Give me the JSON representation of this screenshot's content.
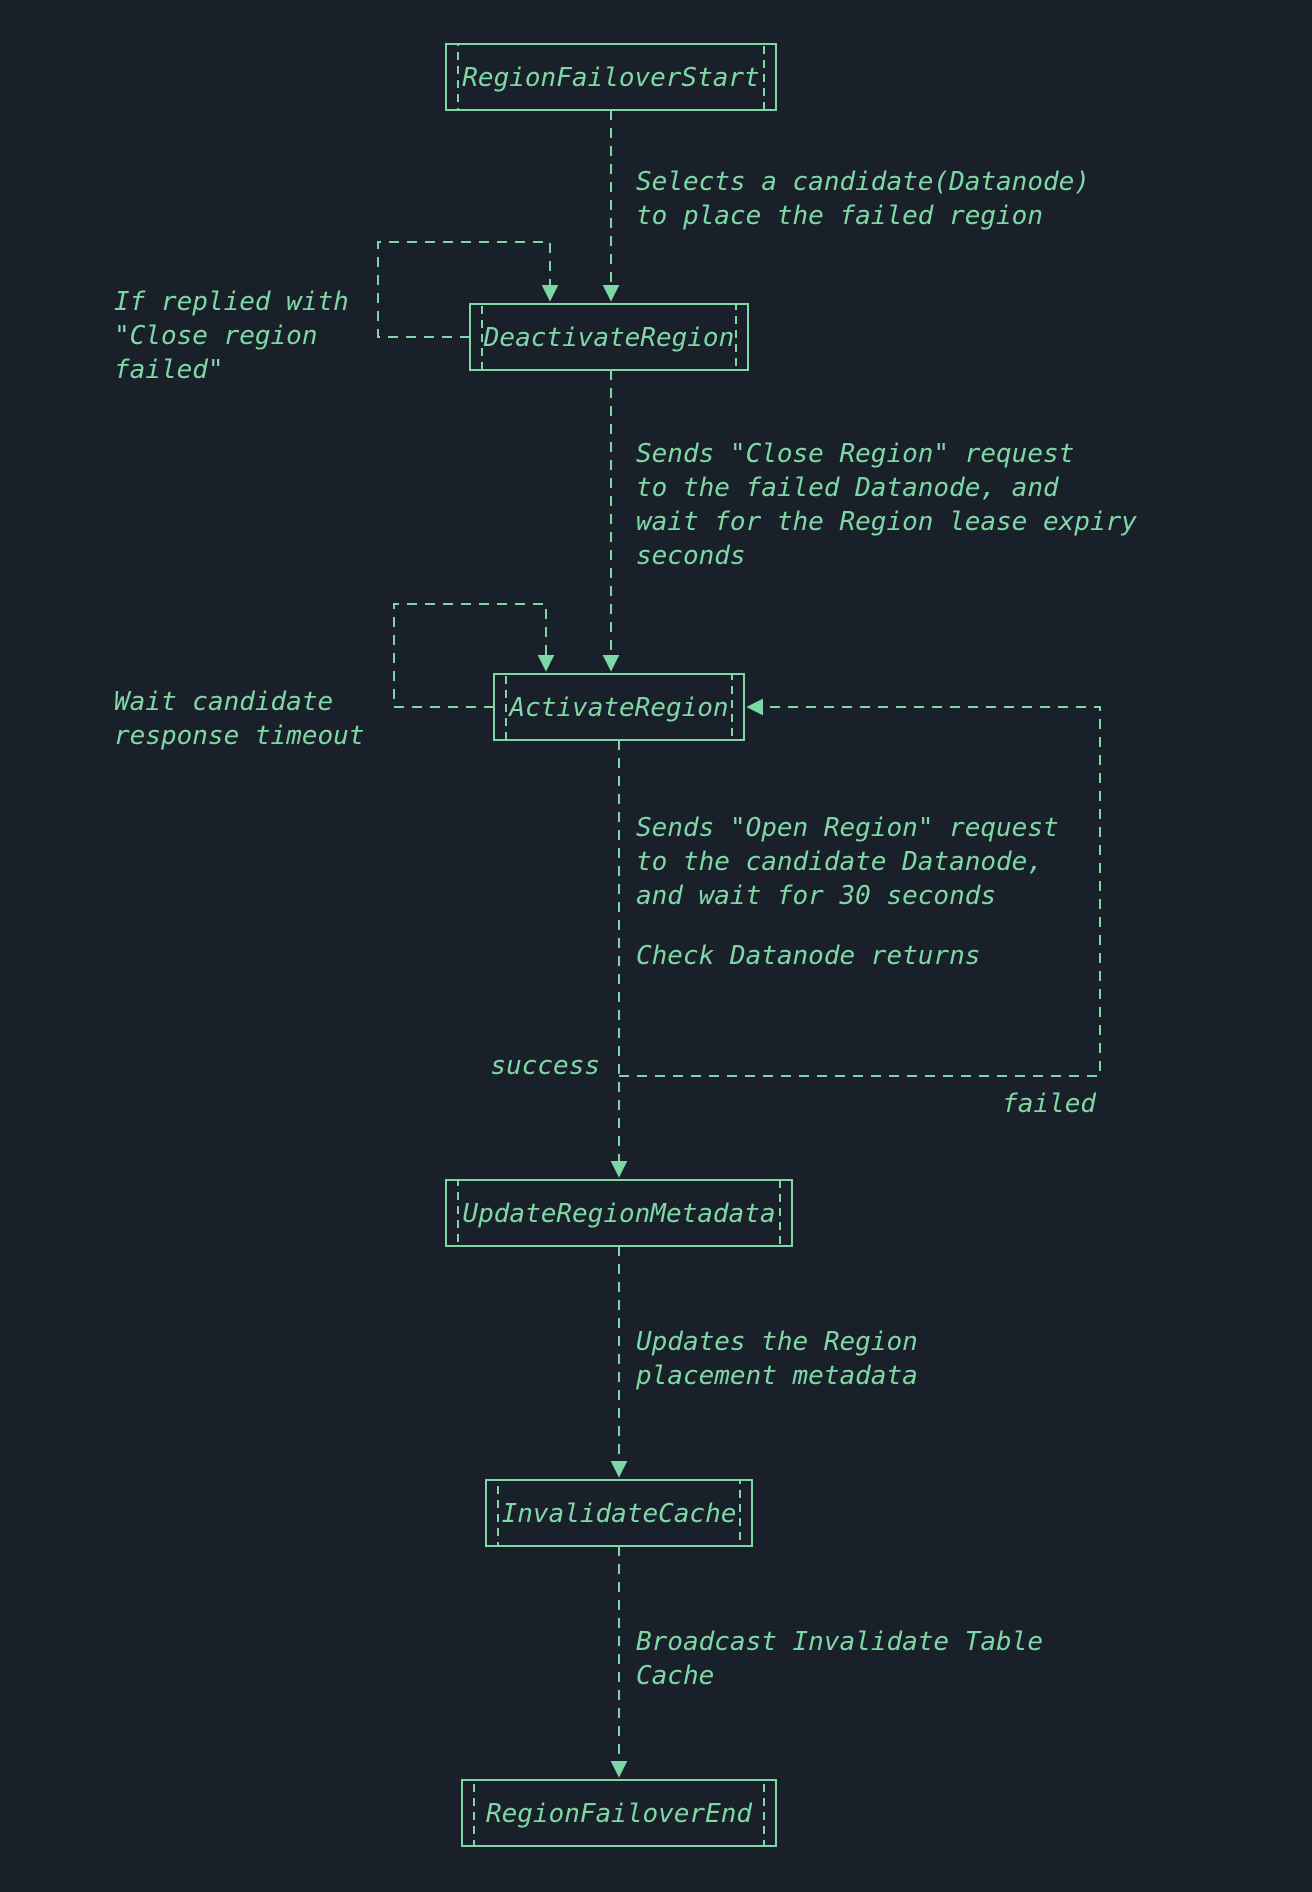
{
  "nodes": {
    "start": "RegionFailoverStart",
    "deact": "DeactivateRegion",
    "act": "ActivateRegion",
    "upd": "UpdateRegionMetadata",
    "inv": "InvalidateCache",
    "end": "RegionFailoverEnd"
  },
  "edges": {
    "e1_l1": "Selects a candidate(Datanode)",
    "e1_l2": "to place the failed region",
    "loop1_l1": "If replied with",
    "loop1_l2": "\"Close region",
    "loop1_l3": "failed\"",
    "e2_l1": "Sends \"Close Region\" request",
    "e2_l2": "to the failed Datanode, and",
    "e2_l3": "wait for the Region lease expiry",
    "e2_l4": "seconds",
    "loop2_l1": "Wait candidate",
    "loop2_l2": "response timeout",
    "e3_l1": "Sends \"Open Region\" request",
    "e3_l2": "to the candidate Datanode,",
    "e3_l3": "and wait for 30 seconds",
    "e3_l4": "Check Datanode returns",
    "success": "success",
    "failed": "failed",
    "e4_l1": "Updates the Region",
    "e4_l2": "placement metadata",
    "e5_l1": "Broadcast Invalidate Table",
    "e5_l2": "Cache"
  },
  "colors": {
    "bg": "#1a2029",
    "fg": "#7dd8a5"
  }
}
